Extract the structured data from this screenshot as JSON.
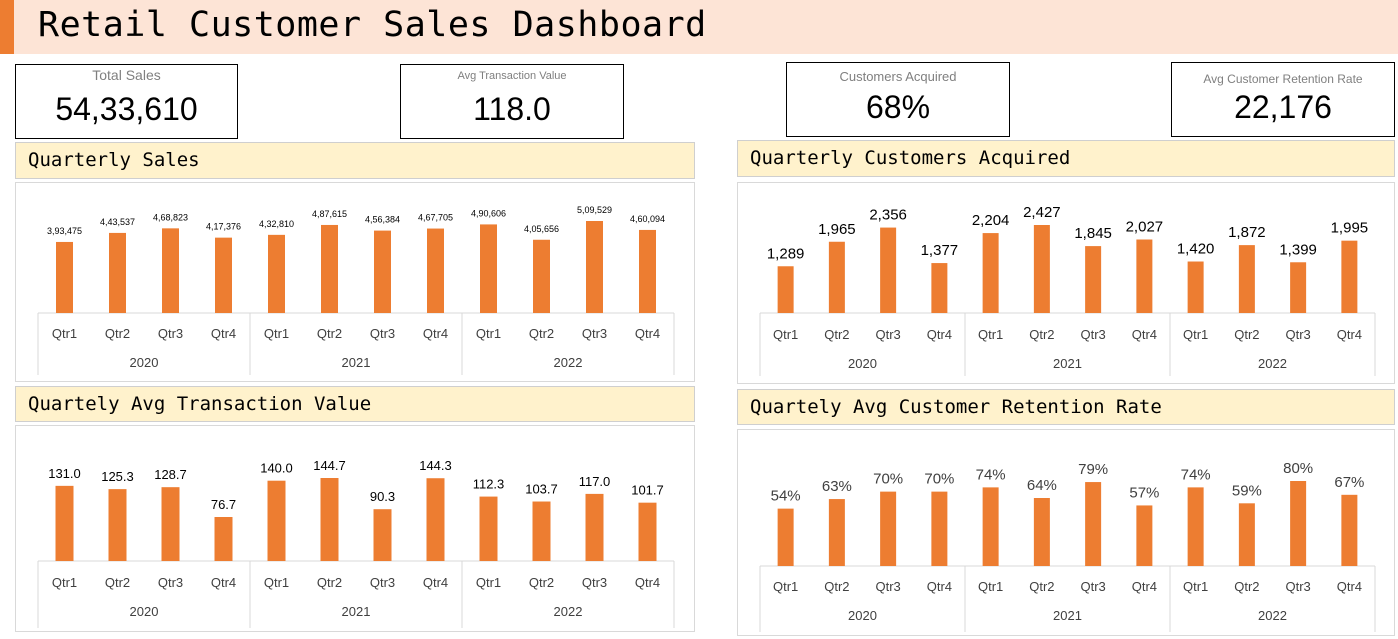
{
  "title": "Retail Customer Sales Dashboard",
  "colors": {
    "accent": "#ed7d31",
    "title_bg": "#fde4d6",
    "header_bg": "#fff2cc",
    "bar": "#ed7d31"
  },
  "kpis": [
    {
      "label": "Total Sales",
      "value": "54,33,610"
    },
    {
      "label": "Avg Transaction Value",
      "value": "118.0"
    },
    {
      "label": "Customers Acquired",
      "value": "68%"
    },
    {
      "label": "Avg Customer Retention Rate",
      "value": "22,176"
    }
  ],
  "chart_titles": {
    "sales": "Quarterly Sales",
    "customers": "Quarterly Customers Acquired",
    "atv": "Quartely Avg Transaction Value",
    "retention": "Quartely Avg Customer Retention Rate"
  },
  "chart_data": [
    {
      "id": "sales",
      "type": "bar",
      "categories": [
        "Qtr1",
        "Qtr2",
        "Qtr3",
        "Qtr4",
        "Qtr1",
        "Qtr2",
        "Qtr3",
        "Qtr4",
        "Qtr1",
        "Qtr2",
        "Qtr3",
        "Qtr4"
      ],
      "groups": [
        "2020",
        "2021",
        "2022"
      ],
      "values": [
        393475,
        443537,
        468823,
        417376,
        432810,
        487615,
        456384,
        467705,
        490606,
        405656,
        509529,
        460094
      ],
      "labels": [
        "3,93,475",
        "4,43,537",
        "4,68,823",
        "4,17,376",
        "4,32,810",
        "4,87,615",
        "4,56,384",
        "4,67,705",
        "4,90,606",
        "4,05,656",
        "5,09,529",
        "4,60,094"
      ]
    },
    {
      "id": "customers",
      "type": "bar",
      "categories": [
        "Qtr1",
        "Qtr2",
        "Qtr3",
        "Qtr4",
        "Qtr1",
        "Qtr2",
        "Qtr3",
        "Qtr4",
        "Qtr1",
        "Qtr2",
        "Qtr3",
        "Qtr4"
      ],
      "groups": [
        "2020",
        "2021",
        "2022"
      ],
      "values": [
        1289,
        1965,
        2356,
        1377,
        2204,
        2427,
        1845,
        2027,
        1420,
        1872,
        1399,
        1995
      ],
      "labels": [
        "1,289",
        "1,965",
        "2,356",
        "1,377",
        "2,204",
        "2,427",
        "1,845",
        "2,027",
        "1,420",
        "1,872",
        "1,399",
        "1,995"
      ]
    },
    {
      "id": "atv",
      "type": "bar",
      "categories": [
        "Qtr1",
        "Qtr2",
        "Qtr3",
        "Qtr4",
        "Qtr1",
        "Qtr2",
        "Qtr3",
        "Qtr4",
        "Qtr1",
        "Qtr2",
        "Qtr3",
        "Qtr4"
      ],
      "groups": [
        "2020",
        "2021",
        "2022"
      ],
      "values": [
        131.0,
        125.3,
        128.7,
        76.7,
        140.0,
        144.7,
        90.3,
        144.3,
        112.3,
        103.7,
        117.0,
        101.7
      ],
      "labels": [
        "131.0",
        "125.3",
        "128.7",
        "76.7",
        "140.0",
        "144.7",
        "90.3",
        "144.3",
        "112.3",
        "103.7",
        "117.0",
        "101.7"
      ]
    },
    {
      "id": "retention",
      "type": "bar",
      "categories": [
        "Qtr1",
        "Qtr2",
        "Qtr3",
        "Qtr4",
        "Qtr1",
        "Qtr2",
        "Qtr3",
        "Qtr4",
        "Qtr1",
        "Qtr2",
        "Qtr3",
        "Qtr4"
      ],
      "groups": [
        "2020",
        "2021",
        "2022"
      ],
      "values": [
        54,
        63,
        70,
        70,
        74,
        64,
        79,
        57,
        74,
        59,
        80,
        67
      ],
      "labels": [
        "54%",
        "63%",
        "70%",
        "70%",
        "74%",
        "64%",
        "79%",
        "57%",
        "74%",
        "59%",
        "80%",
        "67%"
      ]
    }
  ]
}
